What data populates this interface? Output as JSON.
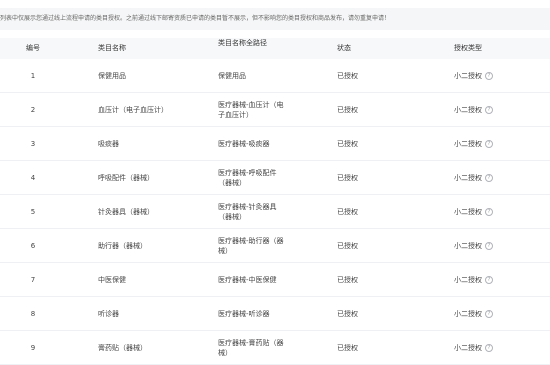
{
  "notice": {
    "text": "列表中仅展示您通过线上流程申请的类目授权。之前通过线下邮寄资质已申请的类目暂不展示，但不影响您的类目授权和商品发布，请勿重复申请！"
  },
  "table": {
    "headers": {
      "no": "编号",
      "name": "类目名称",
      "path": "类目名称全路径",
      "status": "状态",
      "type": "授权类型"
    },
    "rows": [
      {
        "no": "1",
        "name": "保健用品",
        "path": "保健用品",
        "status": "已授权",
        "type": "小二授权"
      },
      {
        "no": "2",
        "name": "血压计（电子血压计）",
        "path": "医疗器械-血压计（电子血压计）",
        "status": "已授权",
        "type": "小二授权"
      },
      {
        "no": "3",
        "name": "吸痰器",
        "path": "医疗器械-吸痰器",
        "status": "已授权",
        "type": "小二授权"
      },
      {
        "no": "4",
        "name": "呼吸配件（器械）",
        "path": "医疗器械-呼吸配件（器械）",
        "status": "已授权",
        "type": "小二授权"
      },
      {
        "no": "5",
        "name": "针灸器具（器械）",
        "path": "医疗器械-针灸器具（器械）",
        "status": "已授权",
        "type": "小二授权"
      },
      {
        "no": "6",
        "name": "助行器（器械）",
        "path": "医疗器械-助行器（器械）",
        "status": "已授权",
        "type": "小二授权"
      },
      {
        "no": "7",
        "name": "中医保健",
        "path": "医疗器械-中医保健",
        "status": "已授权",
        "type": "小二授权"
      },
      {
        "no": "8",
        "name": "听诊器",
        "path": "医疗器械-听诊器",
        "status": "已授权",
        "type": "小二授权"
      },
      {
        "no": "9",
        "name": "膏药贴（器械）",
        "path": "医疗器械-膏药贴（器械）",
        "status": "已授权",
        "type": "小二授权"
      }
    ]
  }
}
